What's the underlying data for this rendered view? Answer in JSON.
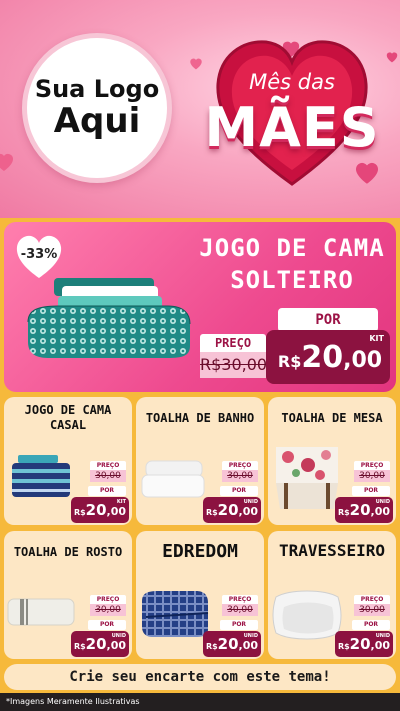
{
  "logo": {
    "line1": "Sua Logo",
    "line2": "Aqui"
  },
  "campaign": {
    "small": "Mês das",
    "big": "MÃES"
  },
  "featured": {
    "discount": "-33%",
    "title_line1": "JOGO DE CAMA",
    "title_line2": "SOLTEIRO",
    "preco_label": "PREÇO",
    "old_price": "R$30,00",
    "por_label": "POR",
    "unit": "KIT",
    "currency": "R$",
    "price_int": "20",
    "price_dec": ",00"
  },
  "products": [
    {
      "title": "JOGO DE CAMA CASAL",
      "preco_label": "PREÇO",
      "old_price": "30,00",
      "por_label": "POR",
      "unit": "KIT",
      "currency": "R$",
      "price_int": "20",
      "price_dec": ",00"
    },
    {
      "title": "TOALHA DE BANHO",
      "preco_label": "PREÇO",
      "old_price": "30,00",
      "por_label": "POR",
      "unit": "UNID",
      "currency": "R$",
      "price_int": "20",
      "price_dec": ",00"
    },
    {
      "title": "TOALHA DE MESA",
      "preco_label": "PREÇO",
      "old_price": "30,00",
      "por_label": "POR",
      "unit": "UNID",
      "currency": "R$",
      "price_int": "20",
      "price_dec": ",00"
    },
    {
      "title": "TOALHA DE ROSTO",
      "preco_label": "PREÇO",
      "old_price": "30,00",
      "por_label": "POR",
      "unit": "UNID",
      "currency": "R$",
      "price_int": "20",
      "price_dec": ",00"
    },
    {
      "title": "EDREDOM",
      "preco_label": "PREÇO",
      "old_price": "30,00",
      "por_label": "POR",
      "unit": "UNID",
      "currency": "R$",
      "price_int": "20",
      "price_dec": ",00"
    },
    {
      "title": "TRAVESSEIRO",
      "preco_label": "PREÇO",
      "old_price": "30,00",
      "por_label": "POR",
      "unit": "UNID",
      "currency": "R$",
      "price_int": "20",
      "price_dec": ",00"
    }
  ],
  "cta": "Crie seu encarte com este tema!",
  "footer": "*Imagens Meramente Ilustrativas",
  "colors": {
    "accent": "#8c1240",
    "pink": "#ee4a8f",
    "card": "#fde7c5",
    "background": "#f6b93b"
  },
  "icons": [
    "heart-icon",
    "discount-heart-icon"
  ]
}
